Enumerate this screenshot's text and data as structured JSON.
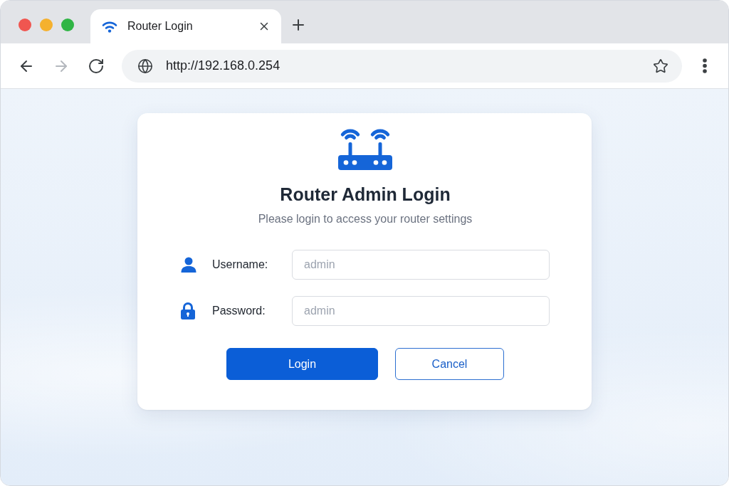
{
  "window": {
    "controls": [
      {
        "color": "#f05650"
      },
      {
        "color": "#f5b12e"
      },
      {
        "color": "#30b545"
      }
    ]
  },
  "tabs": [
    {
      "title": "Router Login",
      "selected": true
    }
  ],
  "toolbar": {
    "navigation": [
      {
        "kind": "back",
        "disabled": false
      },
      {
        "kind": "forward",
        "disabled": true
      },
      {
        "kind": "reload",
        "disabled": false
      }
    ],
    "address_bar": {
      "url": "http://192.168.0.254",
      "starred": false
    }
  },
  "login_card": {
    "title": "Router Admin Login",
    "subtitle": "Please login to access your router settings",
    "fields": [
      {
        "kind": "username",
        "label": "Username:",
        "placeholder": "admin"
      },
      {
        "kind": "password",
        "label": "Password:",
        "placeholder": "admin"
      }
    ],
    "buttons": [
      {
        "kind": "primary",
        "label": "Login"
      },
      {
        "kind": "secondary",
        "label": "Cancel"
      }
    ]
  }
}
